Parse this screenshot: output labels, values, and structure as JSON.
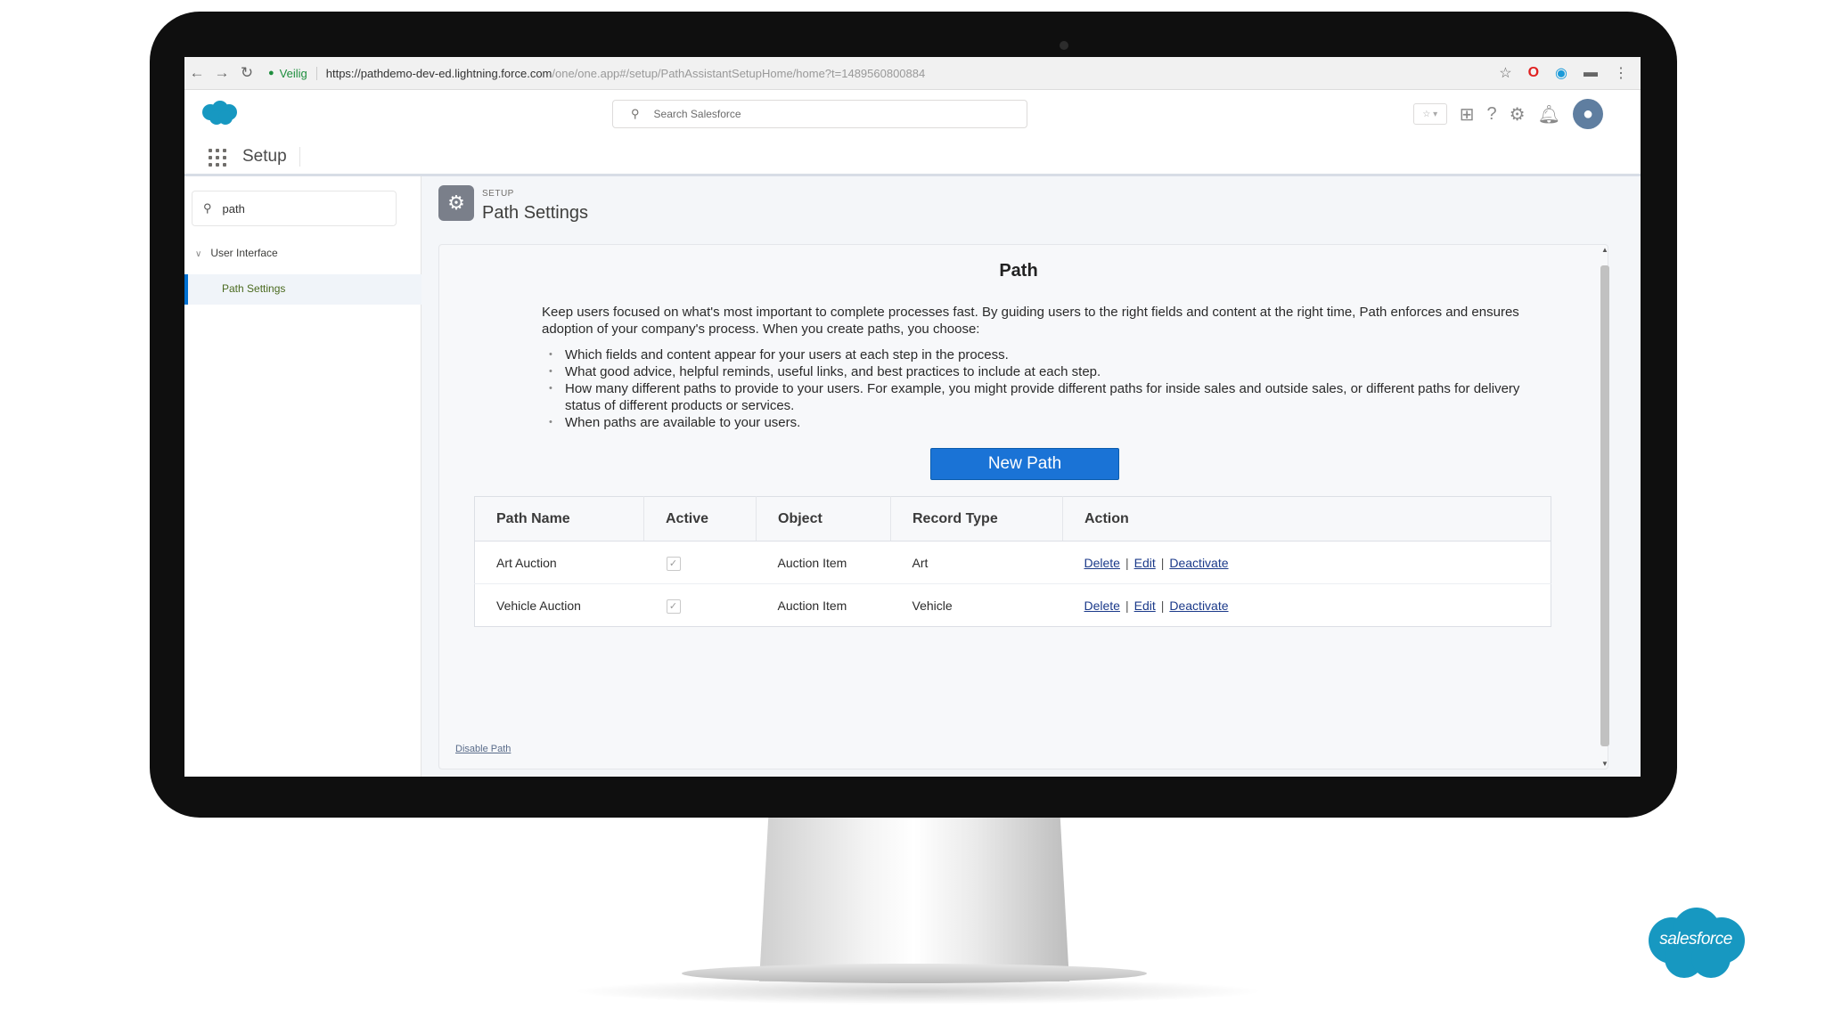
{
  "browser": {
    "back": "←",
    "forward": "→",
    "reload": "C",
    "secure_label": "Veilig",
    "url_main": "https://pathdemo-dev-ed.lightning.force.com",
    "url_rest": "/one/one.app#/setup/PathAssistantSetupHome/home?t=1489560800884"
  },
  "header": {
    "search_placeholder": "Search Salesforce"
  },
  "appbar": {
    "app_name": "Setup"
  },
  "sidebar": {
    "quick_find_value": "path",
    "group_label": "User Interface",
    "selected_item": "Path Settings"
  },
  "page": {
    "eyebrow": "SETUP",
    "title": "Path Settings"
  },
  "card": {
    "title": "Path",
    "intro": "Keep users focused on what's most important to complete processes fast. By guiding users to the right fields and content at the right time, Path enforces and ensures adoption of your company's process. When you create paths, you choose:",
    "bullets": [
      "Which fields and content appear for your users at each step in the process.",
      "What good advice, helpful reminds, useful links, and best practices to include at each step.",
      "How many different paths to provide to your users. For example, you might provide different paths for inside sales and outside sales, or different paths for delivery status of different products or services.",
      "When paths are available to your users."
    ],
    "new_path_label": "New Path",
    "disable_label": "Disable Path"
  },
  "table": {
    "headers": [
      "Path Name",
      "Active",
      "Object",
      "Record Type",
      "Action"
    ],
    "rows": [
      {
        "path_name": "Art Auction",
        "active": true,
        "object": "Auction Item",
        "record_type": "Art"
      },
      {
        "path_name": "Vehicle Auction",
        "active": true,
        "object": "Auction Item",
        "record_type": "Vehicle"
      }
    ],
    "actions": {
      "delete": "Delete",
      "edit": "Edit",
      "deactivate": "Deactivate",
      "sep": "|"
    }
  },
  "brand": {
    "badge_text": "salesforce",
    "color": "#1798c1"
  }
}
